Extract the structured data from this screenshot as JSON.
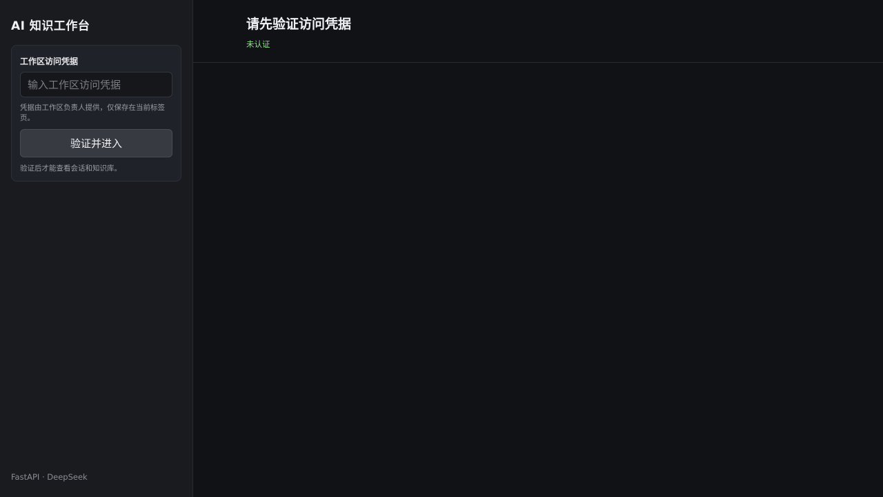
{
  "sidebar": {
    "app_title": "AI 知识工作台",
    "auth_card": {
      "title": "工作区访问凭据",
      "input_placeholder": "输入工作区访问凭据",
      "input_value": "",
      "hint": "凭据由工作区负责人提供，仅保存在当前标签页。",
      "button_label": "验证并进入",
      "note": "验证后才能查看会话和知识库。"
    },
    "footer": "FastAPI · DeepSeek"
  },
  "main": {
    "title": "请先验证访问凭据",
    "status": "未认证"
  },
  "colors": {
    "background": "#111216",
    "sidebar": "#1a1b1f",
    "status_green": "#8fe08a"
  }
}
